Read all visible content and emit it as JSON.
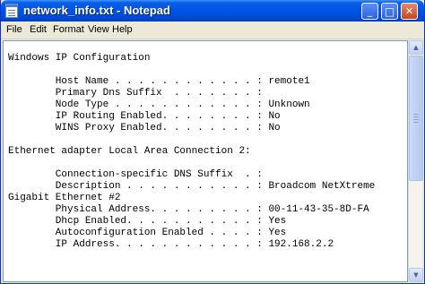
{
  "window": {
    "title": "network_info.txt - Notepad"
  },
  "title_buttons": [
    {
      "name": "minimize-button",
      "glyph": "_"
    },
    {
      "name": "maximize-button",
      "glyph": "□"
    },
    {
      "name": "close-button",
      "glyph": "✕"
    }
  ],
  "menu": [
    "File",
    "Edit",
    "Format",
    "View",
    "Help"
  ],
  "editor": {
    "lines": [
      "",
      "Windows IP Configuration",
      "",
      "        Host Name . . . . . . . . . . . . : remote1",
      "        Primary Dns Suffix  . . . . . . . :",
      "        Node Type . . . . . . . . . . . . : Unknown",
      "        IP Routing Enabled. . . . . . . . : No",
      "        WINS Proxy Enabled. . . . . . . . : No",
      "",
      "Ethernet adapter Local Area Connection 2:",
      "",
      "        Connection-specific DNS Suffix  . :",
      "        Description . . . . . . . . . . . : Broadcom NetXtreme",
      "Gigabit Ethernet #2",
      "        Physical Address. . . . . . . . . : 00-11-43-35-8D-FA",
      "        Dhcp Enabled. . . . . . . . . . . : Yes",
      "        Autoconfiguration Enabled . . . . : Yes",
      "        IP Address. . . . . . . . . . . . : 192.168.2.2"
    ]
  },
  "scrollbar": {
    "up_glyph": "▲",
    "down_glyph": "▼"
  },
  "colors": {
    "titlebar": "#0054e3",
    "chrome": "#ece9d8",
    "close": "#c8441f"
  }
}
